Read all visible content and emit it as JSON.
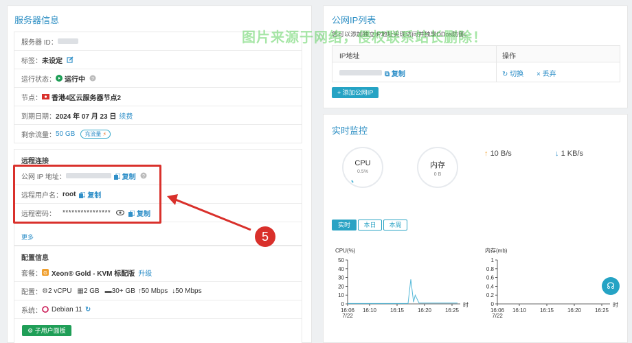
{
  "server": {
    "title": "服务器信息",
    "id_label": "服务器 ID：",
    "tag_label": "标签：",
    "tag_value": "未设定",
    "status_label": "运行状态：",
    "status_value": "运行中",
    "node_label": "节点：",
    "node_value": "香港4区云服务器节点2",
    "expire_label": "到期日期：",
    "expire_value": "2024 年 07 月 23 日",
    "renew_link": "续费",
    "traffic_label": "剩余流量：",
    "traffic_value": "50 GB",
    "traffic_btn": "充流量"
  },
  "remote": {
    "title": "远程连接",
    "ip_label": "公网 IP 地址：",
    "copy_label": "复制",
    "user_label": "远程用户名：",
    "user_value": "root",
    "pwd_label": "远程密码：",
    "pwd_value": "****************",
    "more_link": "更多"
  },
  "config": {
    "title": "配置信息",
    "plan_label": "套餐：",
    "plan_value": "Xeon® Gold - KVM 标配版",
    "upgrade_link": "升级",
    "spec_label": "配置：",
    "spec_cpu": "2 vCPU",
    "spec_ram": "2 GB",
    "spec_disk": "30+ GB",
    "spec_up": "50 Mbps",
    "spec_down": "50 Mbps",
    "os_label": "系统：",
    "os_value": "Debian 11",
    "subuser_btn": "子用户面板"
  },
  "ip_list": {
    "title": "公网IP列表",
    "desc": "您可以添加独立IP地址实现访问并独享DDos防御。",
    "col_ip": "IP地址",
    "col_ops": "操作",
    "copy_label": "复制",
    "switch_label": "切换",
    "drop_label": "丢弃",
    "add_btn": "+ 添加公网IP"
  },
  "watermark": "图片来源于网络，侵权联系站长删除！",
  "monitor": {
    "title": "实时监控",
    "cpu_label": "CPU",
    "cpu_value": "0.5%",
    "mem_label": "内存",
    "mem_value": "0 B",
    "net_up": "10 B/s",
    "net_down": "1 KB/s",
    "tabs": [
      "实时",
      "本日",
      "本周"
    ],
    "active_tab": "实时"
  },
  "annotation_number": "5",
  "chart_data": [
    {
      "type": "line",
      "title": "CPU(%)",
      "xlabel": "时",
      "ylim": [
        0,
        50
      ],
      "yticks": [
        0,
        10,
        20,
        30,
        40,
        50
      ],
      "xticks": [
        "16:06\n7/22",
        "16:10",
        "16:15",
        "16:20",
        "16:25"
      ],
      "x": [
        "16:06",
        "16:10",
        "16:15",
        "16:17",
        "16:17.5",
        "16:18",
        "16:18.3",
        "16:19",
        "16:25",
        "16:26"
      ],
      "series": [
        {
          "values": [
            0.5,
            0.5,
            0.5,
            0.5,
            28,
            2,
            10,
            1,
            1,
            1
          ]
        }
      ],
      "color": "#53b8d8"
    },
    {
      "type": "line",
      "title": "内存(mb)",
      "xlabel": "时",
      "ylim": [
        0,
        1
      ],
      "yticks": [
        0,
        0.2,
        0.4,
        0.6,
        0.8,
        1
      ],
      "xticks": [
        "16:06\n7/22",
        "16:10",
        "16:15",
        "16:20",
        "16:25"
      ],
      "series": [
        {
          "values": []
        }
      ],
      "color": "#53b8d8"
    }
  ],
  "colors": {
    "accent": "#2e8fc4",
    "green": "#1f9e57",
    "teal": "#25a3c4",
    "red": "#d9302b"
  }
}
